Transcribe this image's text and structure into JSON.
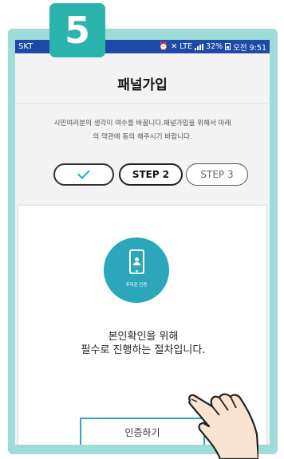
{
  "badge": {
    "number": "5"
  },
  "statusbar": {
    "carrier": "SKT",
    "network": "LTE",
    "battery": "32%",
    "time": "오전 9:51"
  },
  "page": {
    "title": "패널가입",
    "description_line1": "시민여러분의 생각이 여수를 바꿉니다.패널가입을 위해서 아래",
    "description_line2": "의 약관에 동의 해주시기 바랍니다."
  },
  "steps": {
    "step1_state": "completed",
    "step2_label": "STEP 2",
    "step3_label": "STEP 3"
  },
  "auth": {
    "icon_label": "휴대폰 인증",
    "message_line1": "본인확인을 위해",
    "message_line2": "필수로 진행하는 절차입니다.",
    "button_label": "인증하기"
  },
  "colors": {
    "frame": "#9fdcd8",
    "badge": "#2bb3ae",
    "statusbar": "#1d4aa8",
    "accent": "#2ba6bb"
  }
}
